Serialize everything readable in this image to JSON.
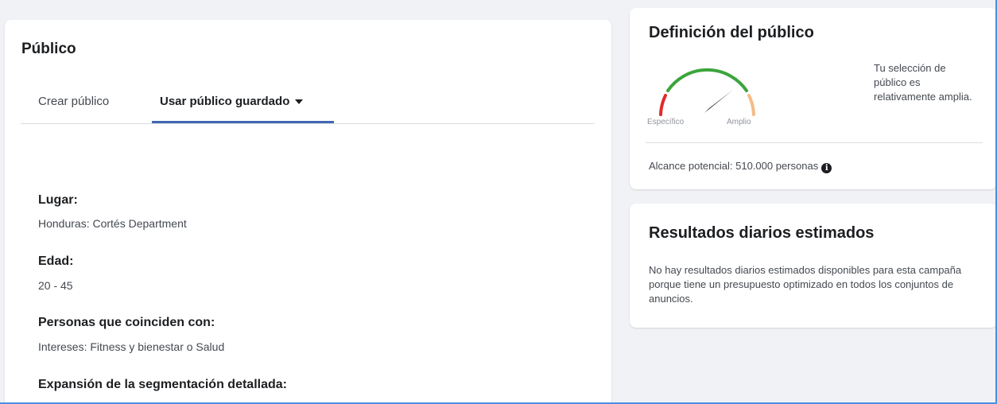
{
  "publico": {
    "title": "Público",
    "tabs": [
      {
        "label": "Crear público"
      },
      {
        "label": "Usar público guardado"
      }
    ],
    "sections": [
      {
        "label": "Lugar:",
        "value": "Honduras: Cortés Department"
      },
      {
        "label": "Edad:",
        "value": "20 - 45"
      },
      {
        "label": "Personas que coinciden con:",
        "value": "Intereses: Fitness y bienestar o Salud"
      },
      {
        "label": "Expansión de la segmentación detallada:"
      }
    ]
  },
  "definicion": {
    "title": "Definición del público",
    "gauge": {
      "left_label": "Específico",
      "right_label": "Amplio",
      "colors": {
        "specific": "#e02b2b",
        "mid": "#3ca53c",
        "broad": "#f5bb86",
        "needle": "#1c1e21"
      }
    },
    "description": "Tu selección de público es relativamente amplia.",
    "reach": "Alcance potencial: 510.000 personas",
    "info_icon": "info-icon"
  },
  "resultados": {
    "title": "Resultados diarios estimados",
    "text": "No hay resultados diarios estimados disponibles para esta campaña porque tiene un presupuesto optimizado en todos los conjuntos de anuncios."
  }
}
